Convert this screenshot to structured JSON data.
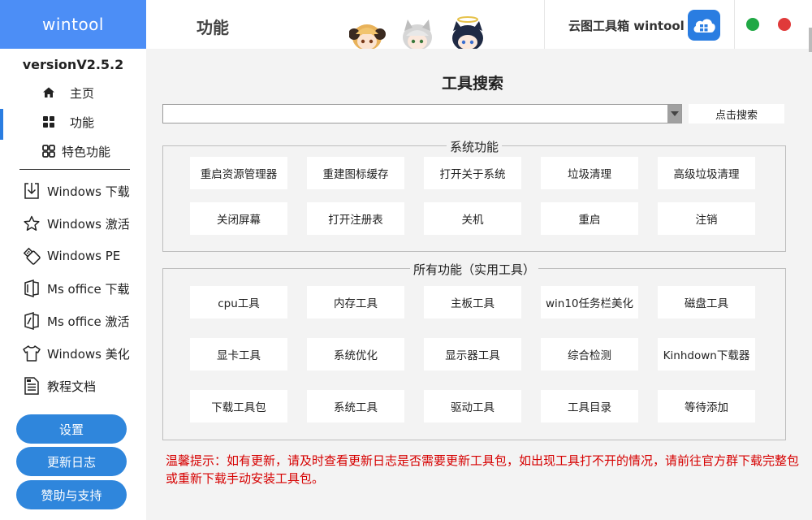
{
  "sidebar": {
    "brand": "wintool",
    "version": "versionV2.5.2",
    "nav": [
      {
        "label": "主页",
        "icon": "home-icon"
      },
      {
        "label": "功能",
        "icon": "grid-icon"
      },
      {
        "label": "特色功能",
        "icon": "feature-grid-icon"
      }
    ],
    "tools": [
      {
        "label": "Windows 下载",
        "icon": "download-icon"
      },
      {
        "label": "Windows 激活",
        "icon": "star-icon"
      },
      {
        "label": "Windows PE",
        "icon": "usb-icon"
      },
      {
        "label": "Ms office 下载",
        "icon": "office-icon"
      },
      {
        "label": "Ms office 激活",
        "icon": "office-key-icon"
      },
      {
        "label": "Windows 美化",
        "icon": "shirt-icon"
      },
      {
        "label": "教程文档",
        "icon": "document-icon"
      }
    ],
    "buttons": {
      "settings": "设置",
      "changelog": "更新日志",
      "support": "赞助与支持"
    }
  },
  "header": {
    "title": "功能",
    "cloud_label": "云图工具箱 wintool",
    "cloud_icon": "cloud-grid-icon"
  },
  "main": {
    "title": "工具搜索",
    "search": {
      "value": "",
      "placeholder": "",
      "button": "点击搜索"
    },
    "system_group": {
      "title": "系统功能",
      "buttons": [
        "重启资源管理器",
        "重建图标缓存",
        "打开关于系统",
        "垃圾清理",
        "高级垃圾清理",
        "关闭屏幕",
        "打开注册表",
        "关机",
        "重启",
        "注销"
      ]
    },
    "all_group": {
      "title": "所有功能（实用工具）",
      "buttons": [
        "cpu工具",
        "内存工具",
        "主板工具",
        "win10任务栏美化",
        "磁盘工具",
        "显卡工具",
        "系统优化",
        "显示器工具",
        "综合检测",
        "Kinhdown下载器",
        "下载工具包",
        "系统工具",
        "驱动工具",
        "工具目录",
        "等待添加"
      ]
    },
    "notice": "温馨提示：如有更新，请及时查看更新日志是否需要更新工具包，如出现工具打不开的情况，请前往官方群下载完整包或重新下载手动安装工具包。"
  },
  "colors": {
    "brand": "#4c8ef6",
    "accent": "#2f86dc",
    "green": "#20a845",
    "red": "#e03a3a",
    "notice": "#d60000"
  }
}
